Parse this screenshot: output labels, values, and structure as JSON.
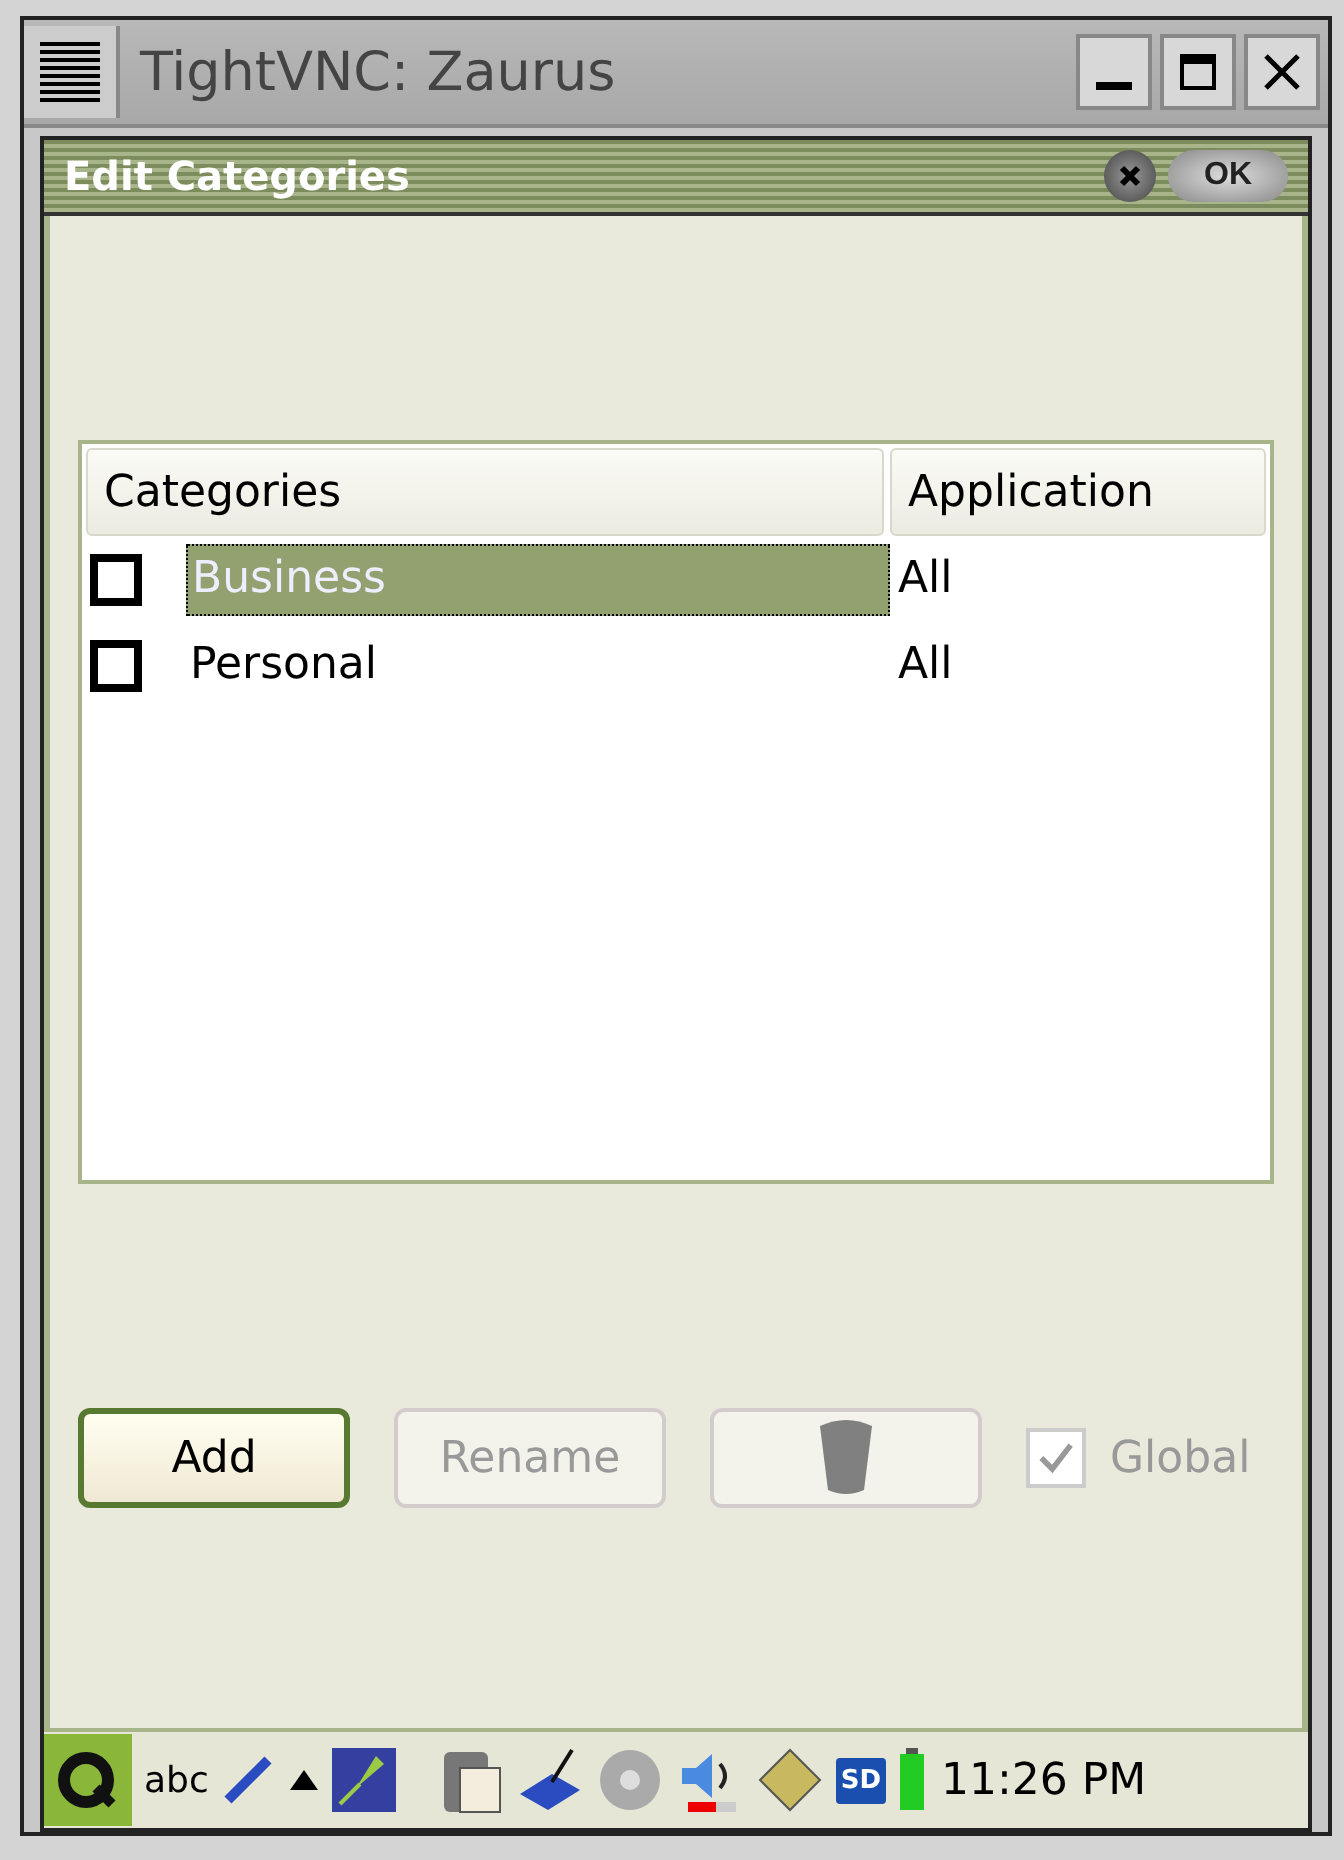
{
  "window": {
    "title": "TightVNC: Zaurus"
  },
  "dialog": {
    "title": "Edit Categories",
    "ok_label": "OK"
  },
  "table": {
    "columns": [
      "Categories",
      "Application"
    ],
    "rows": [
      {
        "checked": false,
        "selected": true,
        "name": "Business",
        "application": "All"
      },
      {
        "checked": false,
        "selected": false,
        "name": "Personal",
        "application": "All"
      }
    ]
  },
  "buttons": [
    {
      "kind": "text",
      "label": "Add",
      "disabled": false
    },
    {
      "kind": "text",
      "label": "Rename",
      "disabled": true
    },
    {
      "kind": "trash",
      "disabled": true
    }
  ],
  "global": {
    "label": "Global",
    "checked": true,
    "disabled": true
  },
  "taskbar": {
    "input_label": "abc",
    "sd_label": "SD",
    "clock": "11:26 PM"
  }
}
